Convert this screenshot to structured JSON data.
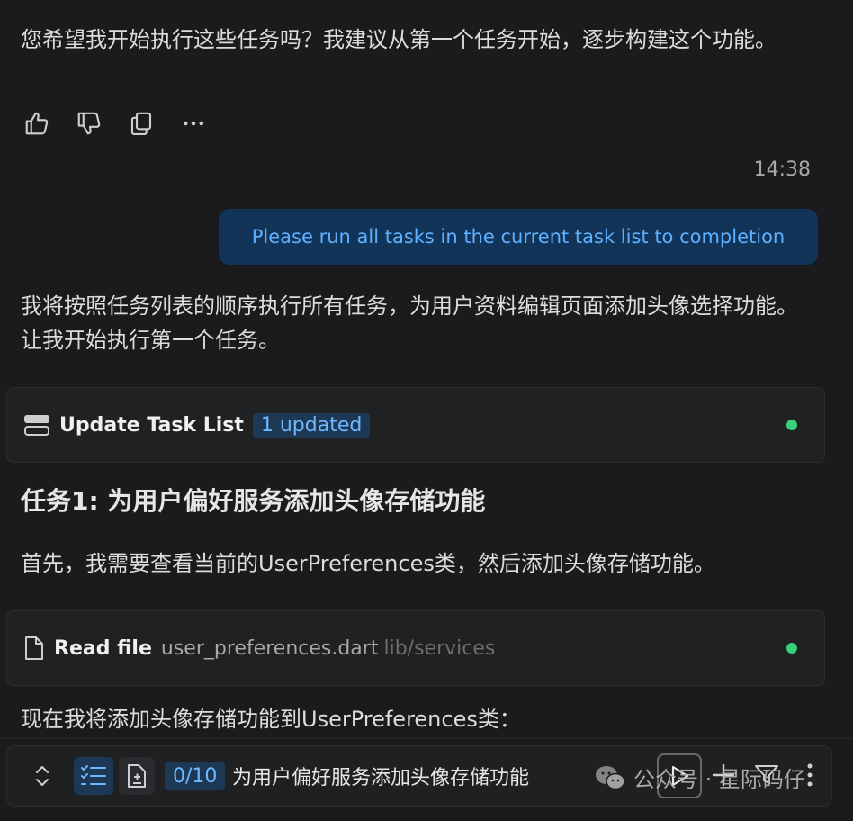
{
  "assistant_msg_1": "您希望我开始执行这些任务吗？我建议从第一个任务开始，逐步构建这个功能。",
  "actions": {
    "thumbs_up": "thumbs-up-icon",
    "thumbs_down": "thumbs-down-icon",
    "copy": "copy-icon",
    "more": "more-icon"
  },
  "timestamp": "14:38",
  "user_message": "Please run all tasks in the current task list to completion",
  "assistant_msg_2": "我将按照任务列表的顺序执行所有任务，为用户资料编辑页面添加头像选择功能。让我开始执行第一个任务。",
  "task_list_card": {
    "title": "Update Task List",
    "badge": "1 updated",
    "status_color": "#38d07a"
  },
  "section_heading": "任务1: 为用户偏好服务添加头像存储功能",
  "assistant_msg_3": "首先，我需要查看当前的UserPreferences类，然后添加头像存储功能。",
  "read_file_card": {
    "title": "Read file",
    "file_name": "user_preferences.dart",
    "file_path": "lib/services",
    "status_color": "#38d07a"
  },
  "assistant_msg_4": "现在我将添加头像存储功能到UserPreferences类：",
  "bottom_bar": {
    "progress": "0/10",
    "current_task": "为用户偏好服务添加头像存储功能"
  },
  "watermark": "公众号 · 星际码仔",
  "colors": {
    "background": "#1b1b1d",
    "user_bubble": "#123458",
    "accent": "#6db8ff",
    "status_green": "#38d07a"
  }
}
